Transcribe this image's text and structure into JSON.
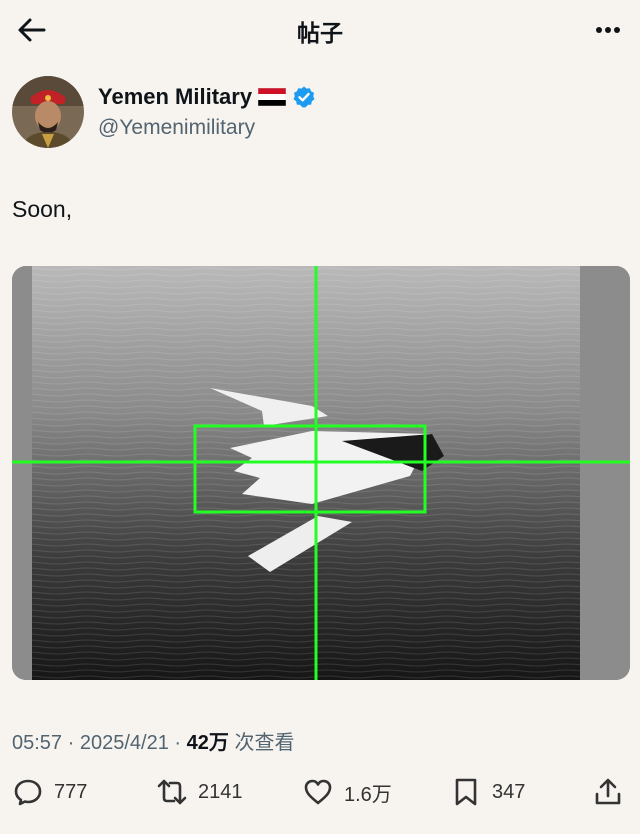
{
  "header": {
    "title": "帖子"
  },
  "author": {
    "name": "Yemen Military",
    "flag": "🇾🇪",
    "handle": "@Yemenimilitary",
    "verified": true
  },
  "post": {
    "text": "Soon,",
    "time": "05:57",
    "date": "2025/4/21",
    "views_count": "42万",
    "views_label": "次查看",
    "separator": "·"
  },
  "actions": {
    "replies": "777",
    "reposts": "2141",
    "likes": "1.6万",
    "bookmarks": "347"
  },
  "colors": {
    "accent": "#1d9bf0",
    "crosshair": "#22ff22",
    "muted": "#536471"
  }
}
